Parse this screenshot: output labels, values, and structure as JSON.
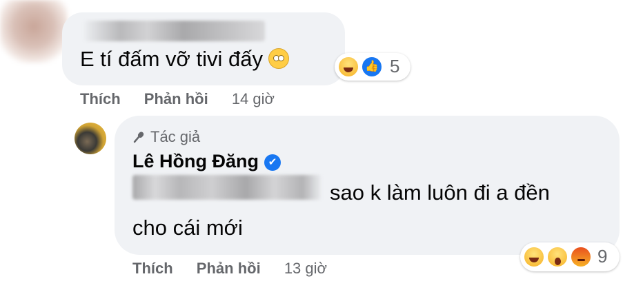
{
  "comment1": {
    "text": "E tí đấm vỡ tivi đấy",
    "reaction_count": "5",
    "actions": {
      "like": "Thích",
      "reply": "Phản hồi",
      "time": "14 giờ"
    }
  },
  "comment2": {
    "badge": "Tác giả",
    "author": "Lê Hồng Đăng",
    "text_line1": "sao k làm luôn đi a đền",
    "text_line2": "cho cái mới",
    "reaction_count": "9",
    "actions": {
      "like": "Thích",
      "reply": "Phản hồi",
      "time": "13 giờ"
    }
  },
  "colors": {
    "bubble": "#f0f2f5",
    "meta_text": "#65676b",
    "verified": "#1877f2"
  }
}
